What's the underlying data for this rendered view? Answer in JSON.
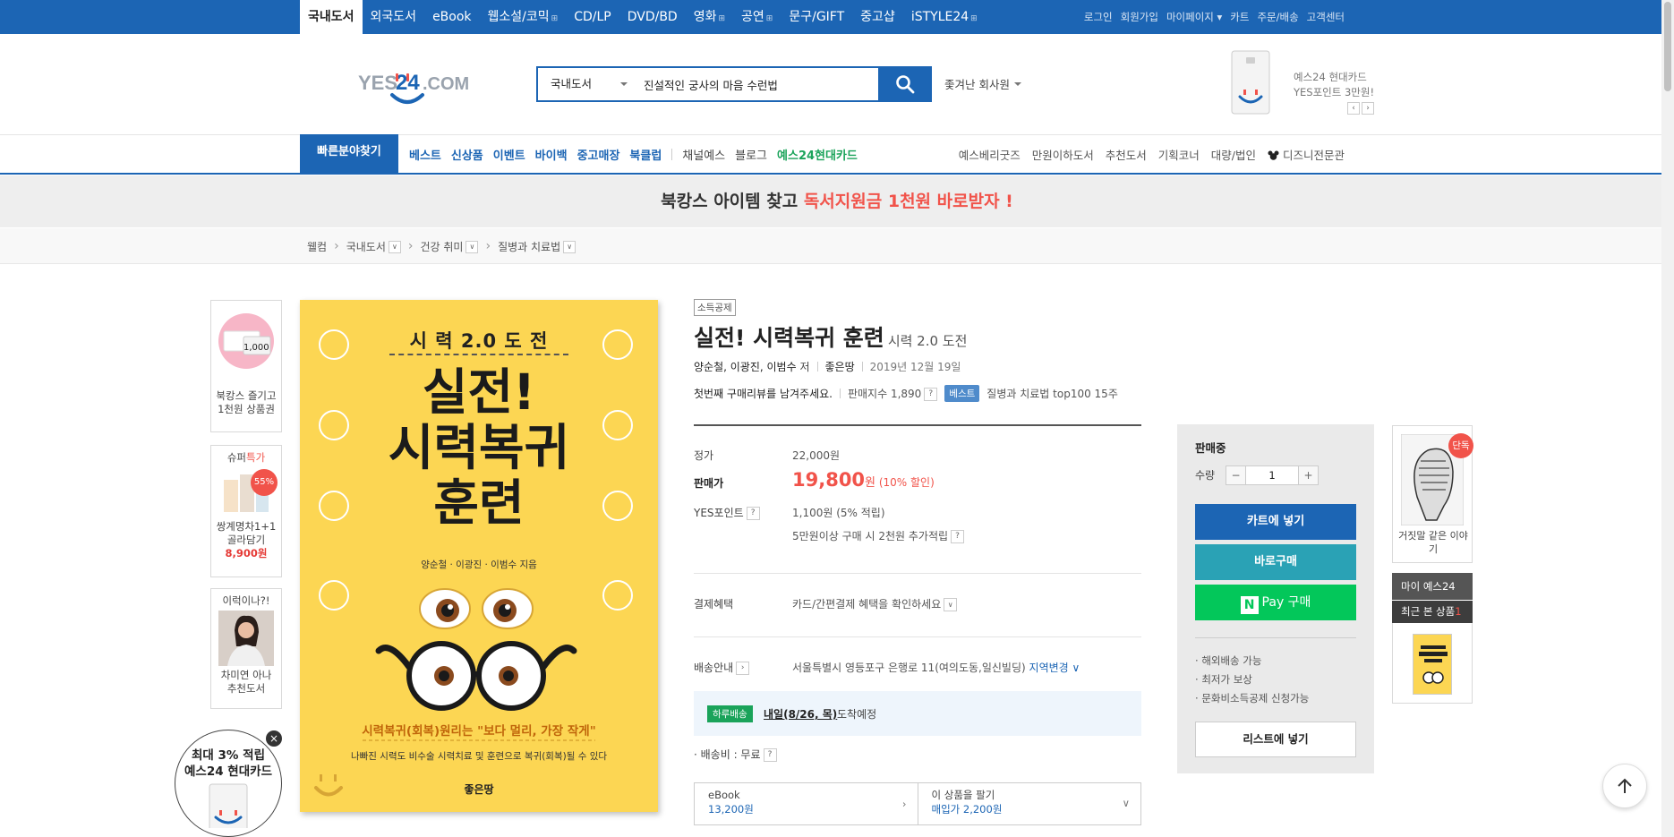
{
  "topbar": {
    "categories": [
      {
        "label": "국내도서",
        "plus": false
      },
      {
        "label": "외국도서",
        "plus": false
      },
      {
        "label": "eBook",
        "plus": false
      },
      {
        "label": "웹소설/코믹",
        "plus": true
      },
      {
        "label": "CD/LP",
        "plus": false
      },
      {
        "label": "DVD/BD",
        "plus": false
      },
      {
        "label": "영화",
        "plus": true
      },
      {
        "label": "공연",
        "plus": true
      },
      {
        "label": "문구/GIFT",
        "plus": false
      },
      {
        "label": "중고샵",
        "plus": false
      },
      {
        "label": "iSTYLE24",
        "plus": true
      }
    ],
    "util": [
      "로그인",
      "회원가입",
      "마이페이지 ▾",
      "카트",
      "주문/배송",
      "고객센터"
    ]
  },
  "header": {
    "logo_text": "YES24.COM",
    "search_category": "국내도서",
    "search_value": "진설적인 궁사의 마음 수런법",
    "suggestion": "좇겨난 회사원",
    "card_ad": {
      "line1": "예스24 현대카드",
      "line2": "YES포인트 3만원!"
    }
  },
  "nav": {
    "quick": "빠른분야찾기",
    "main_blue": [
      "베스트",
      "신상품",
      "이벤트",
      "바이백",
      "중고매장",
      "북클럽"
    ],
    "main_gray": [
      "채널예스",
      "블로그"
    ],
    "main_green": "예스24현대카드",
    "right": [
      "예스베리굿즈",
      "만원이하도서",
      "추천도서",
      "기획코너",
      "대량/법인",
      "디즈니전문관"
    ]
  },
  "banner": {
    "text": "북캉스 아이템 찾고 ",
    "highlight": "독서지원금 1천원 바로받자 !"
  },
  "breadcrumb": [
    "웰컴",
    "국내도서",
    "건강 취미",
    "질병과 치료법"
  ],
  "left_panels": {
    "p1": {
      "badge": "1,000",
      "line1": "북캉스 즐기고",
      "line2": "1천원 상품권"
    },
    "p2": {
      "title_a": "슈퍼",
      "title_b": "특가",
      "discount": "55%",
      "line1": "쌍계명차1+1",
      "line2": "골라담기",
      "price": "8,900원"
    },
    "p3": {
      "title": "이럭이나?!",
      "line1": "차미연 아나",
      "line2": "추천도서"
    },
    "card_circle": {
      "line1": "최대 3% 적립",
      "line2": "예스24 현대카드"
    }
  },
  "cover": {
    "top": "시 력  2.0  도 전",
    "title1": "실전!",
    "title2": "시력복귀",
    "title3": "훈련",
    "authors": "양순철 · 이광진 · 이범수 지음",
    "tagline": "시력복귀(회복)원리는 \"보다 멀리, 가장 작게\"",
    "subline": "나빠진 시력도 비수술 시력치료 및 훈련으로 복귀(회복)될 수 있다",
    "publisher": "좋은땅"
  },
  "product": {
    "tax_badge": "소득공제",
    "title": "실전! 시력복귀 훈련",
    "subtitle": "시력 2.0 도전",
    "authors": "양순철, 이광진, 이범수",
    "author_suffix": "저",
    "publisher": "좋은땅",
    "date": "2019년 12월 19일",
    "review_prompt": "첫번째 구매리뷰를 남겨주세요.",
    "sales_index": "판매지수 1,890",
    "best_badge": "베스트",
    "best_rank": "질병과 치료법 top100 15주"
  },
  "price": {
    "list_label": "정가",
    "list_value": "22,000원",
    "sale_label": "판매가",
    "sale_value": "19,800",
    "sale_unit": "원",
    "discount": "(10% 할인)",
    "point_label": "YES포인트",
    "point_value": "1,100원 (5% 적립)",
    "point_extra": "5만원이상 구매 시 2천원 추가적립",
    "pay_label": "결제혜택",
    "pay_value": "카드/간편결제 혜택을 확인하세요",
    "ship_label": "배송안내",
    "ship_addr": "서울특별시 영등포구 은행로 11(여의도동,일신빌딩)",
    "ship_change": "지역변경",
    "ship_badge": "하루배송",
    "ship_date": "내일(8/26, 목)",
    "ship_arrive": "도착예정",
    "ship_fee": "· 배송비 : 무료"
  },
  "ebook": {
    "label": "eBook",
    "price": "13,200원",
    "sell_label": "이 상품을 팔기",
    "sell_price": "매입가 2,200원"
  },
  "buy": {
    "status": "판매중",
    "qty_label": "수량",
    "qty_value": "1",
    "cart": "카트에 넣기",
    "buy_now": "바로구매",
    "npay": "Pay 구매",
    "notes": [
      "해외배송 가능",
      "최저가 보상",
      "문화비소득공제 신청가능"
    ],
    "wishlist": "리스트에 넣기"
  },
  "right_side": {
    "badge": "단독",
    "book_title": "거짓말 같은 이야기",
    "my_yes": "마이 예스24",
    "recent": "최근 본 상품",
    "recent_count": "1"
  },
  "colors": {
    "brand_blue": "#1c65b4",
    "sale_red": "#f1534a",
    "npay_green": "#03c75a",
    "teal": "#2aa2b5"
  }
}
